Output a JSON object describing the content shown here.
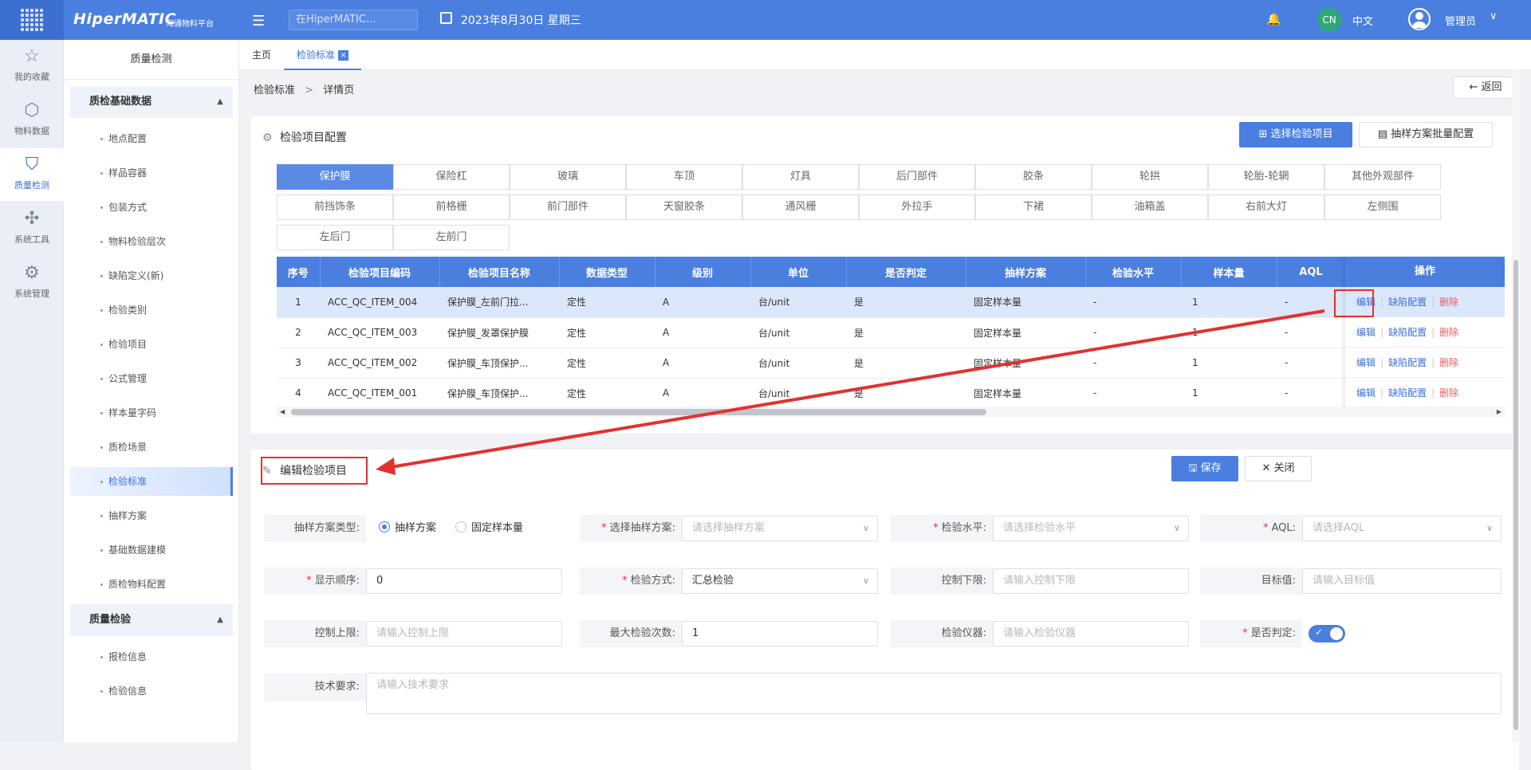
{
  "app": {
    "logo": "HiperMATIC",
    "logo_sub": "海通物料平台",
    "search_placeholder": "在HiperMATIC...",
    "date": "2023年8月30日 星期三",
    "lang_badge": "CN",
    "lang": "中文",
    "user": "管理员"
  },
  "iconbar": [
    {
      "label": "我的收藏",
      "icon": "star-icon"
    },
    {
      "label": "物料数据",
      "icon": "cube-icon"
    },
    {
      "label": "质量检测",
      "icon": "shield-check-icon",
      "active": true
    },
    {
      "label": "系统工具",
      "icon": "network-icon"
    },
    {
      "label": "系统管理",
      "icon": "settings-box-icon"
    }
  ],
  "sidebar": {
    "title": "质量检测",
    "group1": "质检基础数据",
    "items1": [
      "地点配置",
      "样品容器",
      "包装方式",
      "物料检验层次",
      "缺陷定义(新)",
      "检验类别",
      "检验项目",
      "公式管理",
      "样本量字码",
      "质检场景",
      "检验标准",
      "抽样方案",
      "基础数据建模",
      "质检物料配置"
    ],
    "group2": "质量检验",
    "items2": [
      "报检信息",
      "检验信息"
    ]
  },
  "tabs": {
    "home": "主页",
    "current": "检验标准"
  },
  "breadcrumb": {
    "parent": "检验标准",
    "sep": ">",
    "current": "详情页"
  },
  "back": "返回",
  "config": {
    "title": "检验项目配置",
    "select_btn": "选择检验项目",
    "batch_btn": "抽样方案批量配置",
    "categories": [
      "保护膜",
      "保险杠",
      "玻璃",
      "车顶",
      "灯具",
      "后门部件",
      "胶条",
      "轮拱",
      "轮胎-轮辋",
      "其他外观部件",
      "前挡饰条",
      "前格栅",
      "前门部件",
      "天窗胶条",
      "通风栅",
      "外拉手",
      "下裙",
      "油箱盖",
      "右前大灯",
      "左侧围",
      "左后门",
      "左前门"
    ],
    "columns": [
      "序号",
      "检验项目编码",
      "检验项目名称",
      "数据类型",
      "级别",
      "单位",
      "是否判定",
      "抽样方案",
      "检验水平",
      "样本量",
      "AQL"
    ],
    "op_header": "操作",
    "rows": [
      [
        "1",
        "ACC_QC_ITEM_004",
        "保护膜_左前门拉...",
        "定性",
        "A",
        "台/unit",
        "是",
        "固定样本量",
        "-",
        "1",
        "-"
      ],
      [
        "2",
        "ACC_QC_ITEM_003",
        "保护膜_发罩保护膜",
        "定性",
        "A",
        "台/unit",
        "是",
        "固定样本量",
        "-",
        "1",
        "-"
      ],
      [
        "3",
        "ACC_QC_ITEM_002",
        "保护膜_车顶保护...",
        "定性",
        "A",
        "台/unit",
        "是",
        "固定样本量",
        "-",
        "1",
        "-"
      ],
      [
        "4",
        "ACC_QC_ITEM_001",
        "保护膜_车顶保护...",
        "定性",
        "A",
        "台/unit",
        "是",
        "固定样本量",
        "-",
        "1",
        "-"
      ]
    ],
    "ops": {
      "edit": "编辑",
      "defect": "缺陷配置",
      "delete": "删除"
    }
  },
  "edit": {
    "title": "编辑检验项目",
    "save": "保存",
    "close": "关闭",
    "fields": {
      "sample_type": "抽样方案类型:",
      "radio1": "抽样方案",
      "radio2": "固定样本量",
      "select_plan": "选择抽样方案:",
      "select_plan_ph": "请选择抽样方案",
      "level": "检验水平:",
      "level_ph": "请选择检验水平",
      "aql": "AQL:",
      "aql_ph": "请选择AQL",
      "order": "显示顺序:",
      "order_val": "0",
      "method": "检验方式:",
      "method_val": "汇总检验",
      "lower": "控制下限:",
      "lower_ph": "请输入控制下限",
      "target": "目标值:",
      "target_ph": "请输入目标值",
      "upper": "控制上限:",
      "upper_ph": "请输入控制上限",
      "max_times": "最大检验次数:",
      "max_times_val": "1",
      "instrument": "检验仪器:",
      "instrument_ph": "请输入检验仪器",
      "judge": "是否判定:",
      "tech": "技术要求:",
      "tech_ph": "请输入技术要求"
    }
  },
  "colors": {
    "primary": "#4a7fe0",
    "highlight": "#e53030"
  }
}
